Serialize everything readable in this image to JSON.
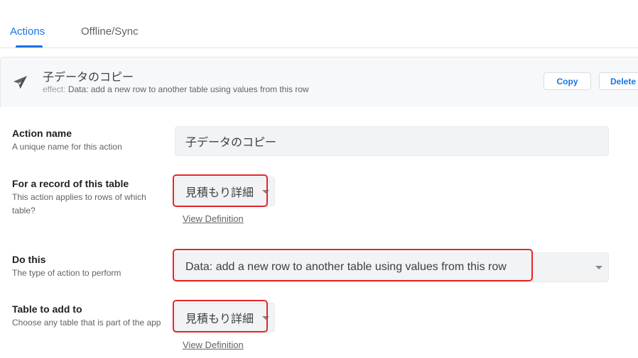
{
  "tabs": [
    {
      "label": "Actions",
      "active": true
    },
    {
      "label": "Offline/Sync",
      "active": false
    }
  ],
  "header": {
    "icon": "paper-plane-icon",
    "title": "子データのコピー",
    "effect_label": "effect:",
    "effect_value": "Data: add a new row to another table using values from this row",
    "copy_label": "Copy",
    "delete_label": "Delete"
  },
  "form": {
    "action_name": {
      "label": "Action name",
      "help": "A unique name for this action",
      "value": "子データのコピー"
    },
    "for_record": {
      "label": "For a record of this table",
      "help": "This action applies to rows of which table?",
      "value": "見積もり詳細",
      "link": "View Definition"
    },
    "do_this": {
      "label": "Do this",
      "help": "The type of action to perform",
      "value": "Data: add a new row to another table using values from this row"
    },
    "table_to_add": {
      "label": "Table to add to",
      "help": "Choose any table that is part of the app",
      "value": "見積もり詳細",
      "link": "View Definition"
    }
  },
  "colors": {
    "accent": "#1a73e8",
    "highlight": "#e8232a"
  }
}
